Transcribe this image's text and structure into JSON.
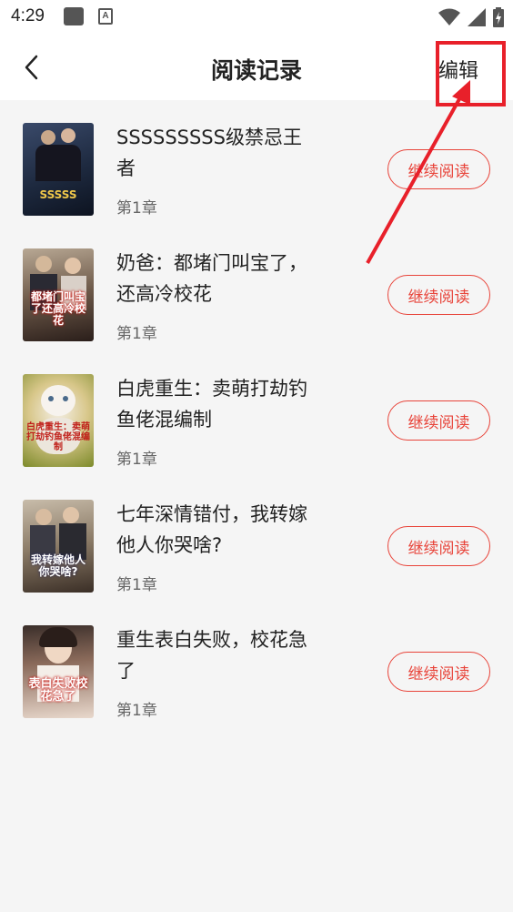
{
  "status_bar": {
    "time": "4:29",
    "a_label": "A"
  },
  "header": {
    "title": "阅读记录",
    "edit_label": "编辑"
  },
  "books": [
    {
      "title": "SSSSSSSSS级禁忌王者",
      "chapter": "第1章",
      "button": "继续阅读",
      "cover_text": "SSSSS"
    },
    {
      "title": "奶爸：都堵门叫宝了，还高冷校花",
      "chapter": "第1章",
      "button": "继续阅读",
      "cover_text": "都堵门叫宝了还高冷校花"
    },
    {
      "title": "白虎重生：卖萌打劫钓鱼佬混编制",
      "chapter": "第1章",
      "button": "继续阅读",
      "cover_text": "白虎重生：卖萌打劫钓鱼佬混编制"
    },
    {
      "title": "七年深情错付，我转嫁他人你哭啥?",
      "chapter": "第1章",
      "button": "继续阅读",
      "cover_text": "我转嫁他人你哭啥?"
    },
    {
      "title": "重生表白失败，校花急了",
      "chapter": "第1章",
      "button": "继续阅读",
      "cover_text": "表白失败校花急了"
    }
  ],
  "colors": {
    "accent": "#e8443a",
    "highlight": "#e8202a"
  },
  "icons": {
    "back": "chevron-left-icon",
    "wifi": "wifi-icon",
    "signal": "signal-icon",
    "battery": "battery-icon"
  }
}
